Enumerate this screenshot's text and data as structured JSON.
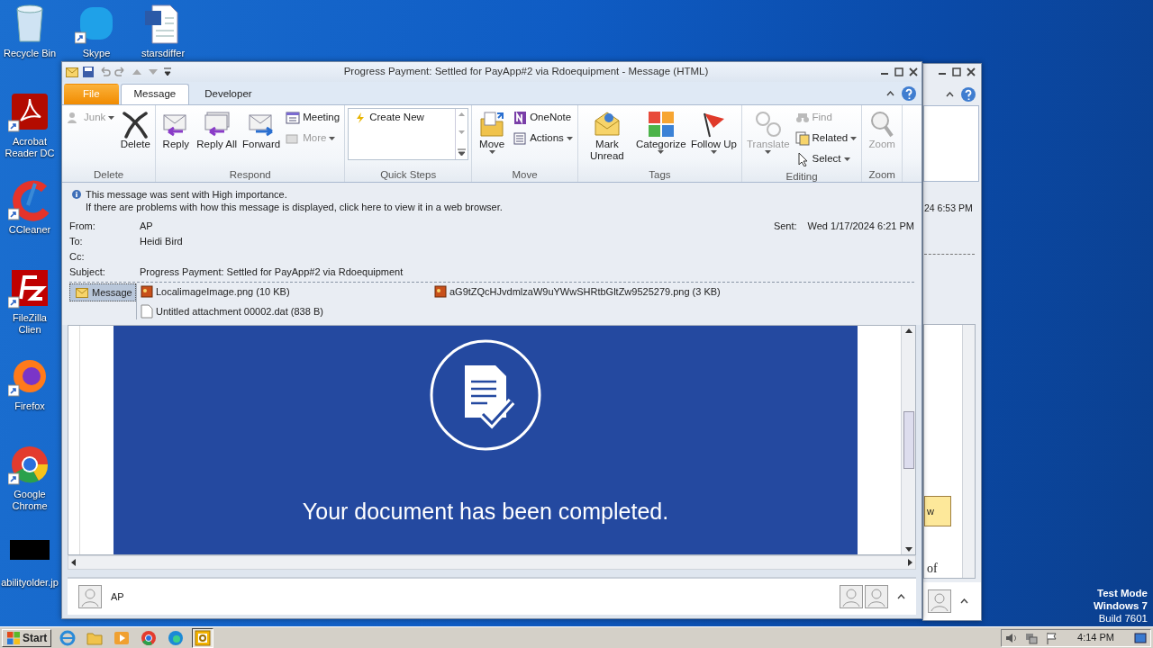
{
  "desktop_icons": [
    {
      "label": "Recycle Bin",
      "kind": "trash"
    },
    {
      "label": "Skype",
      "kind": "chat"
    },
    {
      "label": "starsdiffer",
      "kind": "doc"
    },
    {
      "label": "Acrobat Reader DC",
      "kind": "pdf"
    },
    {
      "label": "CCleaner",
      "kind": "cleaner"
    },
    {
      "label": "FileZilla Clien",
      "kind": "ftp"
    },
    {
      "label": "Firefox",
      "kind": "fox"
    },
    {
      "label": "Google Chrome",
      "kind": "ring"
    },
    {
      "label": "abilityolder.jp",
      "kind": "black"
    }
  ],
  "background_window": {
    "sent_fragment": "24 6:53 PM",
    "button_fragment": "w",
    "text_fragment": "of"
  },
  "message_window": {
    "title": "Progress Payment: Settled for PayApp#2 via Rdoequipment  -  Message (HTML)",
    "tabs": [
      {
        "label": "File",
        "kind": "file",
        "selected": false
      },
      {
        "label": "Message",
        "kind": "tab",
        "selected": true
      },
      {
        "label": "Developer",
        "kind": "tab",
        "selected": false
      }
    ],
    "ribbon_groups": [
      {
        "label": "Delete",
        "buttons": [
          {
            "label": "Junk",
            "kind": "small",
            "disabled": true,
            "dropdown": true
          },
          {
            "label": "Delete",
            "kind": "large",
            "disabled": false,
            "dropdown": false
          }
        ]
      },
      {
        "label": "Respond",
        "buttons": [
          {
            "label": "Reply",
            "kind": "large",
            "disabled": false,
            "dropdown": false
          },
          {
            "label": "Reply All",
            "kind": "large",
            "disabled": false,
            "dropdown": false
          },
          {
            "label": "Forward",
            "kind": "large",
            "disabled": false,
            "dropdown": false
          },
          {
            "label": "Meeting",
            "kind": "small",
            "disabled": false,
            "dropdown": false
          },
          {
            "label": "More",
            "kind": "small",
            "disabled": true,
            "dropdown": true
          }
        ]
      },
      {
        "label": "Quick Steps",
        "buttons": [
          {
            "label": "Create New",
            "kind": "gallery",
            "disabled": false,
            "dropdown": false
          }
        ]
      },
      {
        "label": "Move",
        "buttons": [
          {
            "label": "Move",
            "kind": "large",
            "disabled": false,
            "dropdown": true
          },
          {
            "label": "OneNote",
            "kind": "small",
            "disabled": false,
            "dropdown": false
          },
          {
            "label": "Actions",
            "kind": "small",
            "disabled": false,
            "dropdown": true
          }
        ]
      },
      {
        "label": "Tags",
        "buttons": [
          {
            "label": "Mark Unread",
            "kind": "large",
            "disabled": false,
            "dropdown": false
          },
          {
            "label": "Categorize",
            "kind": "large",
            "disabled": false,
            "dropdown": true
          },
          {
            "label": "Follow Up",
            "kind": "large",
            "disabled": false,
            "dropdown": true
          }
        ]
      },
      {
        "label": "Editing",
        "buttons": [
          {
            "label": "Translate",
            "kind": "large",
            "disabled": true,
            "dropdown": true
          },
          {
            "label": "Find",
            "kind": "small",
            "disabled": true,
            "dropdown": false
          },
          {
            "label": "Related",
            "kind": "small",
            "disabled": false,
            "dropdown": true
          },
          {
            "label": "Select",
            "kind": "small",
            "disabled": false,
            "dropdown": true
          }
        ]
      },
      {
        "label": "Zoom",
        "buttons": [
          {
            "label": "Zoom",
            "kind": "large",
            "disabled": true,
            "dropdown": false
          }
        ]
      }
    ],
    "info_lines": [
      "This message was sent with High importance.",
      "If there are problems with how this message is displayed, click here to view it in a web browser."
    ],
    "fields": [
      {
        "label": "From:",
        "value": "AP"
      },
      {
        "label": "To:",
        "value": "Heidi Bird"
      },
      {
        "label": "Cc:"
      },
      {
        "label": "Subject:",
        "value": "Progress Payment: Settled for PayApp#2 via Rdoequipment"
      }
    ],
    "sent": {
      "label": "Sent:",
      "value": "Wed 1/17/2024 6:21 PM"
    },
    "message_tab": {
      "label": "Message",
      "selected": true
    },
    "attachments": [
      {
        "name": "LocalimageImage.png (10 KB)",
        "kind": "image"
      },
      {
        "name": "aG9tZQcHJvdmlzaW9uYWwSHRtbGltZw9525279.png (3 KB)",
        "kind": "image"
      },
      {
        "name": "Untitled attachment 00002.dat (838 B)",
        "kind": "file"
      }
    ],
    "body_heading": "Your document has been completed.",
    "people_pane": {
      "name": "AP"
    }
  },
  "os_notice": [
    "Test Mode",
    "Windows 7",
    "Build 7601"
  ],
  "taskbar": {
    "start": "Start",
    "apps": [
      {
        "kind": "ie",
        "selected": false
      },
      {
        "kind": "folder",
        "selected": false
      },
      {
        "kind": "media",
        "selected": false
      },
      {
        "kind": "ring",
        "selected": false
      },
      {
        "kind": "edge",
        "selected": false
      },
      {
        "kind": "outlook",
        "selected": true
      }
    ],
    "clock": "4:14 PM"
  }
}
